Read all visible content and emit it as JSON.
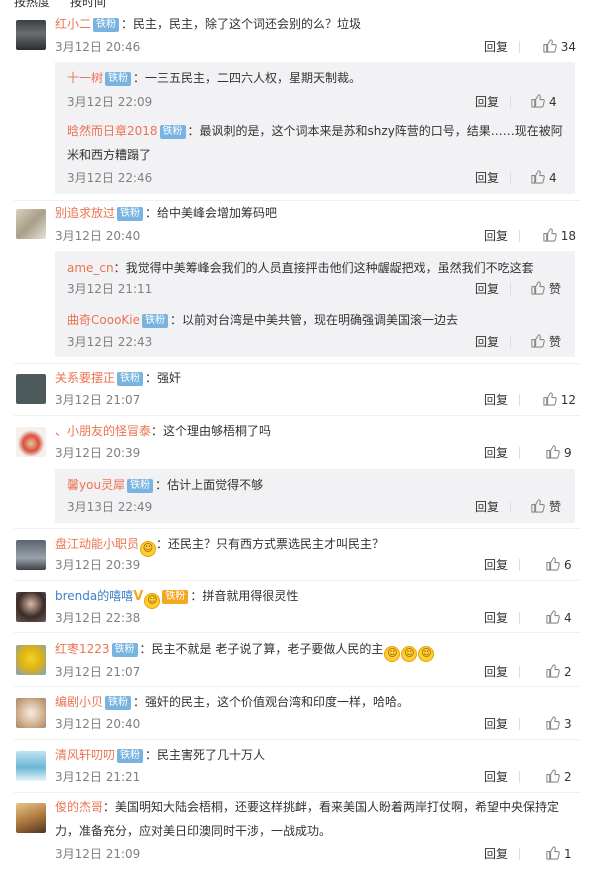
{
  "tabs": {
    "hot": "按热度",
    "time": "按时间"
  },
  "ui": {
    "reply_label": "回复",
    "like_word": "赞",
    "badge_label": "铁粉"
  },
  "comments": [
    {
      "user": "红小二",
      "content": "：民主，民主，除了这个词还会别的么？垃圾",
      "time": "3月12日 20:46",
      "likes": "34",
      "replies": [
        {
          "user": "十一树",
          "content": "：一三五民主，二四六人权，星期天制裁。",
          "time": "3月12日 22:09",
          "likes": "4"
        },
        {
          "user": "晗然而日章2018",
          "content_l1": "：最讽刺的是，这个词本来是苏和shzy阵营的口号，结果……现在被阿",
          "content_l2": "米和西方糟蹋了",
          "time": "3月12日 22:46",
          "likes": "4"
        }
      ]
    },
    {
      "user": "别追求放过",
      "content": "：给中美峰会增加筹码吧",
      "time": "3月12日 20:40",
      "likes": "18",
      "replies": [
        {
          "user": "ame_cn",
          "content": "：我觉得中美筹峰会我们的人员直接抨击他们这种龌龊把戏，虽然我们不吃这套",
          "time": "3月12日 21:11",
          "likes": "赞"
        },
        {
          "user": "曲奇CoooKie",
          "content": "：以前对台湾是中美共管，现在明确强调美国滚一边去",
          "time": "3月12日 22:43",
          "likes": "赞"
        }
      ]
    },
    {
      "user": "关系要摆正",
      "content": "：强奸",
      "time": "3月12日 21:07",
      "likes": "12"
    },
    {
      "user": "、小朋友的怪冒泰",
      "content": "：这个理由够梧桐了吗",
      "time": "3月12日 20:39",
      "likes": "9",
      "replies": [
        {
          "user": "馨you灵犀",
          "content": "：估计上面觉得不够",
          "time": "3月13日 22:49",
          "likes": "赞"
        }
      ]
    },
    {
      "user": "盘江动能小职员",
      "content": "：还民主？只有西方式票选民主才叫民主？",
      "time": "3月12日 20:39",
      "likes": "6"
    },
    {
      "user": "brenda的嘻嘻",
      "content": "：拼音就用得很灵性",
      "time": "3月12日 22:38",
      "likes": "4"
    },
    {
      "user": "红枣1223",
      "content": "：民主不就是 老子说了算，老子要做人民的主",
      "time": "3月12日 21:07",
      "likes": "2"
    },
    {
      "user": "编剧小贝",
      "content": "：强奸的民主，这个价值观台湾和印度一样，哈哈。",
      "time": "3月12日 20:40",
      "likes": "3"
    },
    {
      "user": "清风轩叨叨",
      "content": "：民主害死了几十万人",
      "time": "3月12日 21:21",
      "likes": "2"
    },
    {
      "user": "俊的杰哥",
      "content_l1": "：美国明知大陆会梧桐，还要这样挑衅，看来美国人盼着两岸打仗啊，希望中央保持定",
      "content_l2": "力，准备充分，应对美日印澳同时干涉，一战成功。",
      "time": "3月12日 21:09",
      "likes": "1"
    }
  ],
  "colors": {
    "username": "#eb7350",
    "username_blue": "#3d7fc8",
    "badge": "#79b4e0",
    "reply_bg": "#f2f2f5",
    "time": "#808080"
  },
  "icons": {
    "like": "thumbs-up-icon",
    "vip": "v-icon",
    "emoji": "emoji-icon"
  }
}
